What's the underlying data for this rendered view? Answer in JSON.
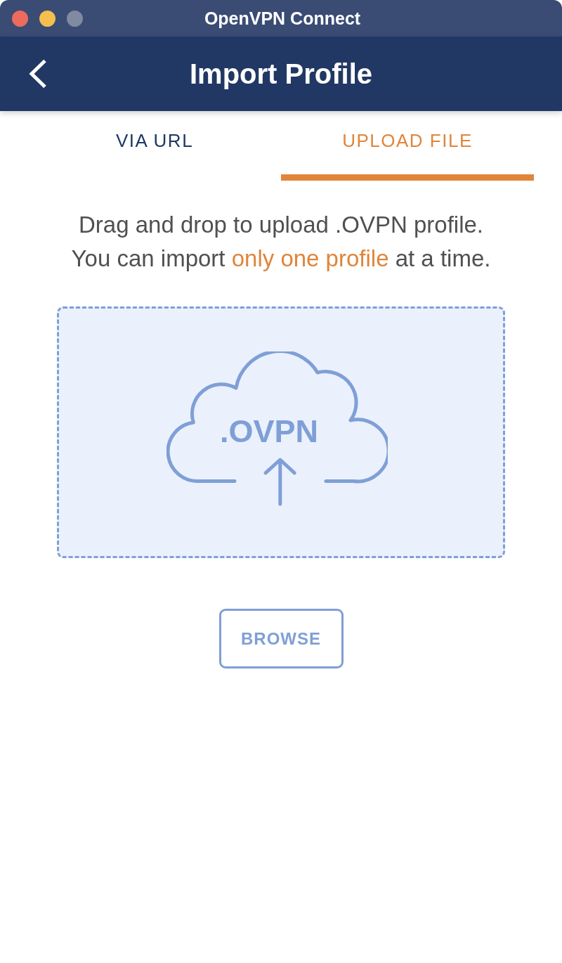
{
  "window": {
    "title": "OpenVPN Connect",
    "controls": [
      {
        "kind": "close",
        "disabled": false
      },
      {
        "kind": "minimize",
        "disabled": false
      },
      {
        "kind": "zoom",
        "disabled": true
      }
    ]
  },
  "header": {
    "title": "Import Profile"
  },
  "tabs": [
    {
      "label": "VIA URL",
      "selected": false
    },
    {
      "label": "UPLOAD FILE",
      "selected": true
    }
  ],
  "instructions": [
    {
      "segments": [
        {
          "text": "Drag and drop to upload .OVPN profile.",
          "highlight": false
        }
      ]
    },
    {
      "segments": [
        {
          "text": "You can import ",
          "highlight": false
        },
        {
          "text": "only one profile",
          "highlight": true
        },
        {
          "text": " at a time.",
          "highlight": false
        }
      ]
    }
  ],
  "drop_zone": {
    "file_type": ".OVPN"
  },
  "browse_button": {
    "label": "BROWSE"
  }
}
